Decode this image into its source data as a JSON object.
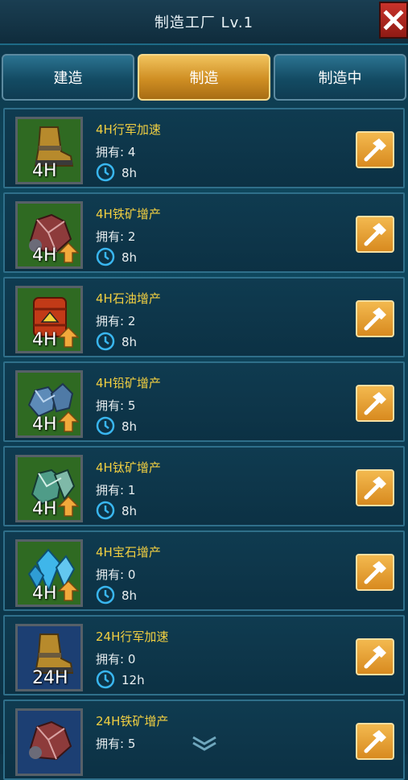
{
  "header": {
    "title": "制造工厂 Lv.1"
  },
  "tabs": [
    {
      "label": "建造",
      "active": false
    },
    {
      "label": "制造",
      "active": true
    },
    {
      "label": "制造中",
      "active": false
    }
  ],
  "items": [
    {
      "name": "4H行军加速",
      "owned": "拥有: 4",
      "time": "8h",
      "thumb": "4H",
      "icon": "boots-icon",
      "boost": false,
      "bg": "green"
    },
    {
      "name": "4H铁矿增产",
      "owned": "拥有: 2",
      "time": "8h",
      "thumb": "4H",
      "icon": "iron-ore-icon",
      "boost": true,
      "bg": "green"
    },
    {
      "name": "4H石油增产",
      "owned": "拥有: 2",
      "time": "8h",
      "thumb": "4H",
      "icon": "oil-barrel-icon",
      "boost": true,
      "bg": "green"
    },
    {
      "name": "4H铅矿增产",
      "owned": "拥有: 5",
      "time": "8h",
      "thumb": "4H",
      "icon": "lead-ore-icon",
      "boost": true,
      "bg": "green"
    },
    {
      "name": "4H钛矿增产",
      "owned": "拥有: 1",
      "time": "8h",
      "thumb": "4H",
      "icon": "titanium-ore-icon",
      "boost": true,
      "bg": "green"
    },
    {
      "name": "4H宝石增产",
      "owned": "拥有: 0",
      "time": "8h",
      "thumb": "4H",
      "icon": "gem-icon",
      "boost": true,
      "bg": "green"
    },
    {
      "name": "24H行军加速",
      "owned": "拥有: 0",
      "time": "12h",
      "thumb": "24H",
      "icon": "boots-icon",
      "boost": false,
      "bg": "blue"
    },
    {
      "name": "24H铁矿增产",
      "owned": "拥有: 5",
      "time": "",
      "thumb": "",
      "icon": "iron-ore-icon",
      "boost": false,
      "bg": "blue"
    }
  ],
  "icons": {
    "close": "close-icon",
    "craft": "hammer-icon",
    "timer": "clock-icon",
    "scroll": "chevron-down-icon"
  },
  "colors": {
    "accent": "#f1cf41",
    "active_tab": "#d8962a",
    "close": "#c9332b"
  }
}
